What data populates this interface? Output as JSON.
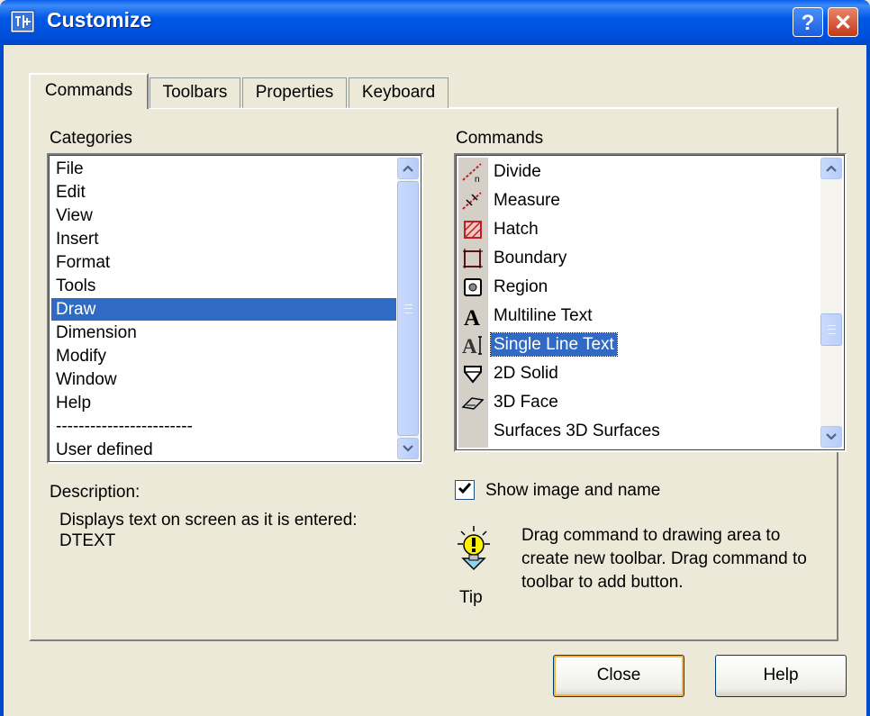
{
  "window": {
    "title": "Customize",
    "help_glyph": "?",
    "close_glyph": "✕"
  },
  "tabs": [
    {
      "label": "Commands",
      "active": true
    },
    {
      "label": "Toolbars",
      "active": false
    },
    {
      "label": "Properties",
      "active": false
    },
    {
      "label": "Keyboard",
      "active": false
    }
  ],
  "categories": {
    "label": "Categories",
    "items": [
      "File",
      "Edit",
      "View",
      "Insert",
      "Format",
      "Tools",
      "Draw",
      "Dimension",
      "Modify",
      "Window",
      "Help",
      "------------------------",
      "User defined"
    ],
    "selected": "Draw"
  },
  "commands": {
    "label": "Commands",
    "items": [
      {
        "label": "Divide",
        "icon": "divide-icon"
      },
      {
        "label": "Measure",
        "icon": "measure-icon"
      },
      {
        "label": "Hatch",
        "icon": "hatch-icon"
      },
      {
        "label": "Boundary",
        "icon": "boundary-icon"
      },
      {
        "label": "Region",
        "icon": "region-icon"
      },
      {
        "label": "Multiline Text",
        "icon": "multiline-text-icon"
      },
      {
        "label": "Single Line Text",
        "icon": "single-line-text-icon"
      },
      {
        "label": "2D Solid",
        "icon": "2d-solid-icon"
      },
      {
        "label": "3D Face",
        "icon": "3d-face-icon"
      },
      {
        "label": "Surfaces 3D Surfaces",
        "icon": "none"
      }
    ],
    "selected": "Single Line Text"
  },
  "description": {
    "label": "Description:",
    "line1": "Displays text on screen as it is entered:",
    "line2": "DTEXT"
  },
  "options": {
    "show_image_and_name_label": "Show image and name",
    "show_image_and_name_checked": true
  },
  "tip": {
    "label": "Tip",
    "line1": "Drag command to drawing area to",
    "line2": "create new toolbar. Drag command to",
    "line3": "toolbar to add button."
  },
  "buttons": {
    "close": "Close",
    "help": "Help"
  },
  "colors": {
    "selection": "#316AC5",
    "title_bar": "#0058E6",
    "dialog_bg": "#ECE9D8"
  }
}
